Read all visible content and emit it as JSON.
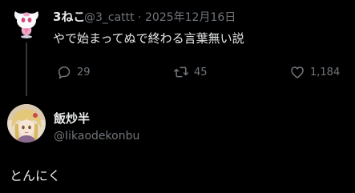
{
  "colors": {
    "background": "#000000",
    "primary_text": "#e7e9ea",
    "secondary_text": "#71767b",
    "thread_line": "#333639"
  },
  "original_tweet": {
    "display_name": "3ねこ",
    "handle": "@3_cattt",
    "separator": "·",
    "date": "2025年12月16日",
    "text": "やで始まってぬで終わる言葉無い説",
    "avatar_icon": "pink-fairy-creature-avatar",
    "actions": {
      "reply": {
        "icon": "speech-bubble-icon",
        "count": "29"
      },
      "retweet": {
        "icon": "retweet-arrows-icon",
        "count": "45"
      },
      "like": {
        "icon": "heart-icon",
        "count": "1,184"
      }
    }
  },
  "reply": {
    "display_name": "飯炒半",
    "handle": "@Iikaodekonbu",
    "avatar_icon": "anime-character-avatar",
    "text": "とんにく"
  }
}
